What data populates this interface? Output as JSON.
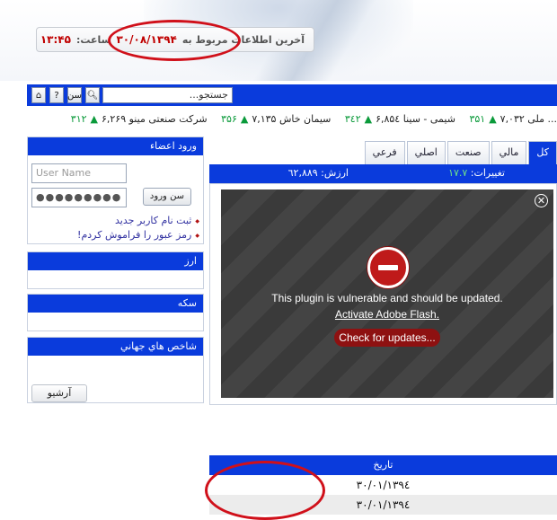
{
  "header": {
    "last_info_label": "آخرين اطلاعات مربوط به",
    "last_info_date": "۳۰/۰۸/۱۳۹۴",
    "time_label": "ساعت:",
    "time_value": "۱۳:۴۵"
  },
  "toolbar": {
    "search_placeholder": "جستجو...",
    "buttons": [
      "home-icon",
      "help-icon",
      "calendar-icon",
      "search-icon"
    ],
    "help_label": "?",
    "calendar_label": "سن"
  },
  "ticker": [
    {
      "name": "... ملی",
      "value": "۷,۰۳۲",
      "change": "۳۵۱"
    },
    {
      "name": "شیمی - سینا",
      "value": "۶,۸۵٤",
      "change": "۳٤۲"
    },
    {
      "name": "سیمان خاش",
      "value": "۷,۱۳۵",
      "change": "۳۵۶"
    },
    {
      "name": "شرکت صنعتی مینو",
      "value": "۶,۲۶۹",
      "change": "۳۱۲"
    }
  ],
  "sidebar": {
    "login": {
      "title": "ورود اعضاء",
      "username_placeholder": "User Name",
      "password_value": "●●●●●●●●●",
      "submit_label": "ورود",
      "submit_icon_label": "سن",
      "register_link": "ثبت نام کاربر جدید",
      "forgot_link": "رمز عبور را فراموش کردم!"
    },
    "currency_title": "ارز",
    "coin_title": "سكه",
    "world_index_title": "شاخص هاي جهاني",
    "archive_label": "آرشیو"
  },
  "main": {
    "tabs": [
      {
        "label": "كل",
        "active": true
      },
      {
        "label": "مالي",
        "active": false
      },
      {
        "label": "صنعت",
        "active": false
      },
      {
        "label": "اصلي",
        "active": false
      },
      {
        "label": "فرعي",
        "active": false
      }
    ],
    "changes_label": "تغييرات:",
    "changes_value": "۱۷.۷",
    "value_label": "ارزش:",
    "value_value": "٦۲,۸۸۹"
  },
  "flash": {
    "message": "This plugin is vulnerable and should be updated.",
    "activate_link": "Activate Adobe Flash.",
    "update_button": "Check for updates..."
  },
  "table": {
    "header": "تاريخ",
    "rows": [
      "۳۰/۰۱/۱۳۹٤",
      "۳۰/۰۱/۱۳۹٤"
    ]
  },
  "colors": {
    "accent": "#0a3bdc",
    "up": "#0a9a3a",
    "annotation": "#d0101a"
  }
}
